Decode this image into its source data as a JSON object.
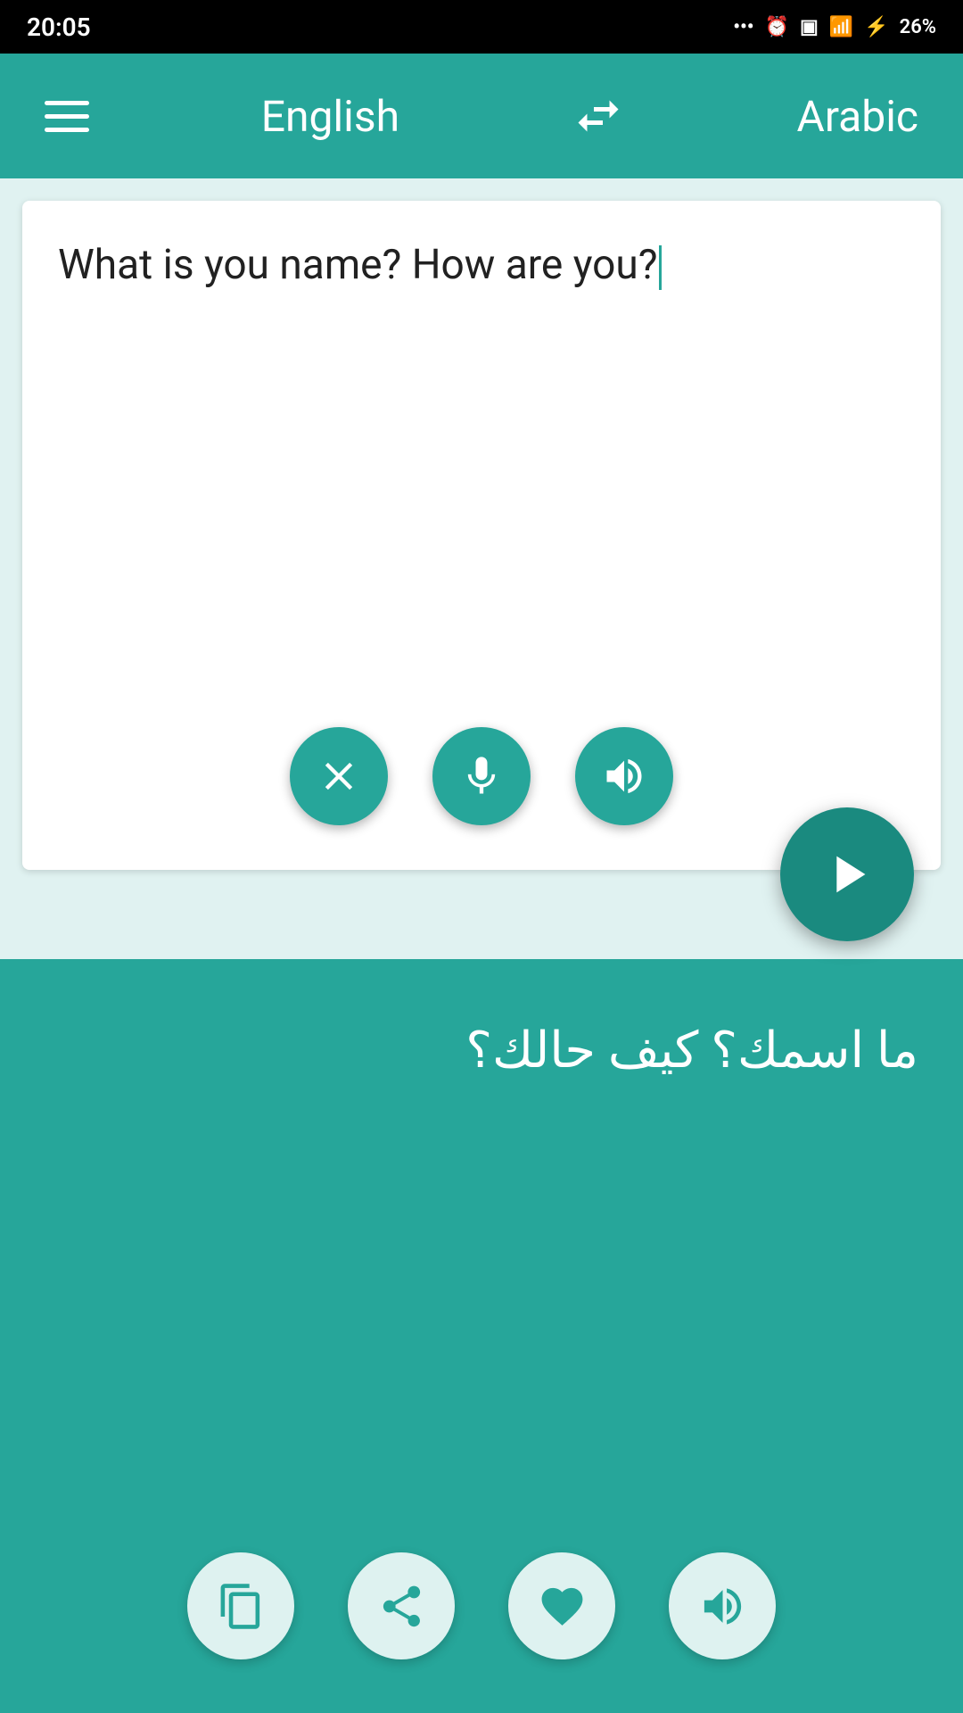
{
  "status_bar": {
    "time": "20:05",
    "battery": "26%"
  },
  "toolbar": {
    "menu_label": "Menu",
    "source_lang": "English",
    "swap_label": "Swap Languages",
    "target_lang": "Arabic"
  },
  "input_panel": {
    "input_text": "What is you name? How are you?",
    "clear_btn": "Clear",
    "mic_btn": "Microphone",
    "speaker_btn": "Speaker",
    "translate_btn": "Translate"
  },
  "output_panel": {
    "output_text": "ما اسمك؟ كيف حالك؟",
    "copy_btn": "Copy",
    "share_btn": "Share",
    "favorite_btn": "Favorite",
    "speaker_btn": "Speaker"
  }
}
